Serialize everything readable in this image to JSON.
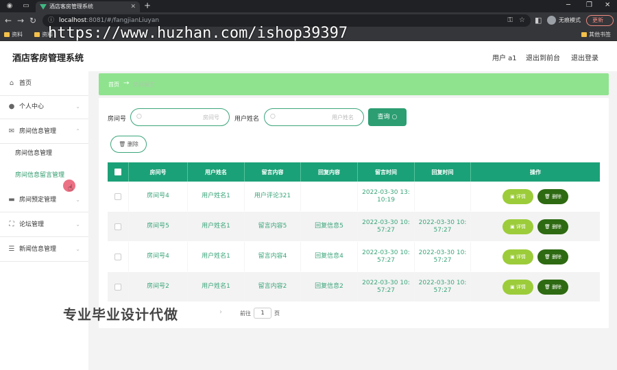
{
  "browser": {
    "tab_title": "酒店客房管理系统",
    "url_host": "localhost",
    "url_path": ":8081/#/fangjianLiuyan",
    "incognito_label": "无痕模式",
    "update_label": "更新",
    "bookmarks": [
      "资料",
      "资料"
    ],
    "other_bookmarks": "其他书签",
    "watermark_url": "https://www.huzhan.com/ishop39397"
  },
  "header": {
    "title": "酒店客房管理系统",
    "user": "用户 a1",
    "to_front": "退出到前台",
    "logout": "退出登录"
  },
  "sidebar": {
    "items": [
      {
        "label": "首页",
        "icon": "home-icon"
      },
      {
        "label": "个人中心",
        "icon": "user-icon"
      },
      {
        "label": "房间信息管理",
        "icon": "mail-icon"
      },
      {
        "label": "房间预定管理",
        "icon": "card-icon"
      },
      {
        "label": "论坛管理",
        "icon": "fullscreen-icon"
      },
      {
        "label": "新闻信息管理",
        "icon": "sliders-icon"
      }
    ],
    "submenu": [
      "房间信息管理",
      "房间信息留言管理"
    ]
  },
  "breadcrumb": {
    "home": "首页",
    "current": "房间留言"
  },
  "search": {
    "room_label": "房间号",
    "room_placeholder": "房间号",
    "user_label": "用户姓名",
    "user_placeholder": "用户姓名",
    "query_label": "查询",
    "delete_label": "删除"
  },
  "table": {
    "headers": [
      "房间号",
      "用户姓名",
      "留言内容",
      "回复内容",
      "留言时间",
      "回复时间",
      "操作"
    ],
    "rows": [
      {
        "room": "房间号4",
        "user": "用户姓名1",
        "content": "用户评论321",
        "reply": "",
        "time": "2022-03-30 13:10:19",
        "reply_time": ""
      },
      {
        "room": "房间号5",
        "user": "用户姓名1",
        "content": "留言内容5",
        "reply": "回复信息5",
        "time": "2022-03-30 10:57:27",
        "reply_time": "2022-03-30 10:57:27"
      },
      {
        "room": "房间号4",
        "user": "用户姓名1",
        "content": "留言内容4",
        "reply": "回复信息4",
        "time": "2022-03-30 10:57:27",
        "reply_time": "2022-03-30 10:57:27"
      },
      {
        "room": "房间号2",
        "user": "用户姓名1",
        "content": "留言内容2",
        "reply": "回复信息2",
        "time": "2022-03-30 10:57:27",
        "reply_time": "2022-03-30 10:57:27"
      }
    ],
    "detail_label": "详情",
    "delete_label": "删除"
  },
  "pager": {
    "overlay_text": "专业毕业设计代做",
    "goto_label": "前往",
    "page_value": "1",
    "page_suffix": "页"
  }
}
